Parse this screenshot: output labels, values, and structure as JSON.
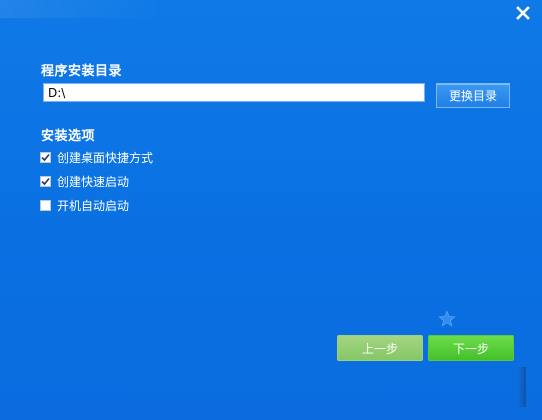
{
  "window": {
    "close_icon": "close-icon"
  },
  "install_dir": {
    "title": "程序安装目录",
    "path_value": "D:\\",
    "change_button_label": "更换目录"
  },
  "options": {
    "title": "安装选项",
    "items": [
      {
        "label": "创建桌面快捷方式",
        "checked": true
      },
      {
        "label": "创建快速启动",
        "checked": true
      },
      {
        "label": "开机自动启动",
        "checked": false
      }
    ]
  },
  "footer": {
    "prev_label": "上一步",
    "next_label": "下一步",
    "star_icon": "star-icon"
  },
  "colors": {
    "background": "#0a70e2",
    "prev_button": "#86c766",
    "next_button": "#45c02a"
  }
}
